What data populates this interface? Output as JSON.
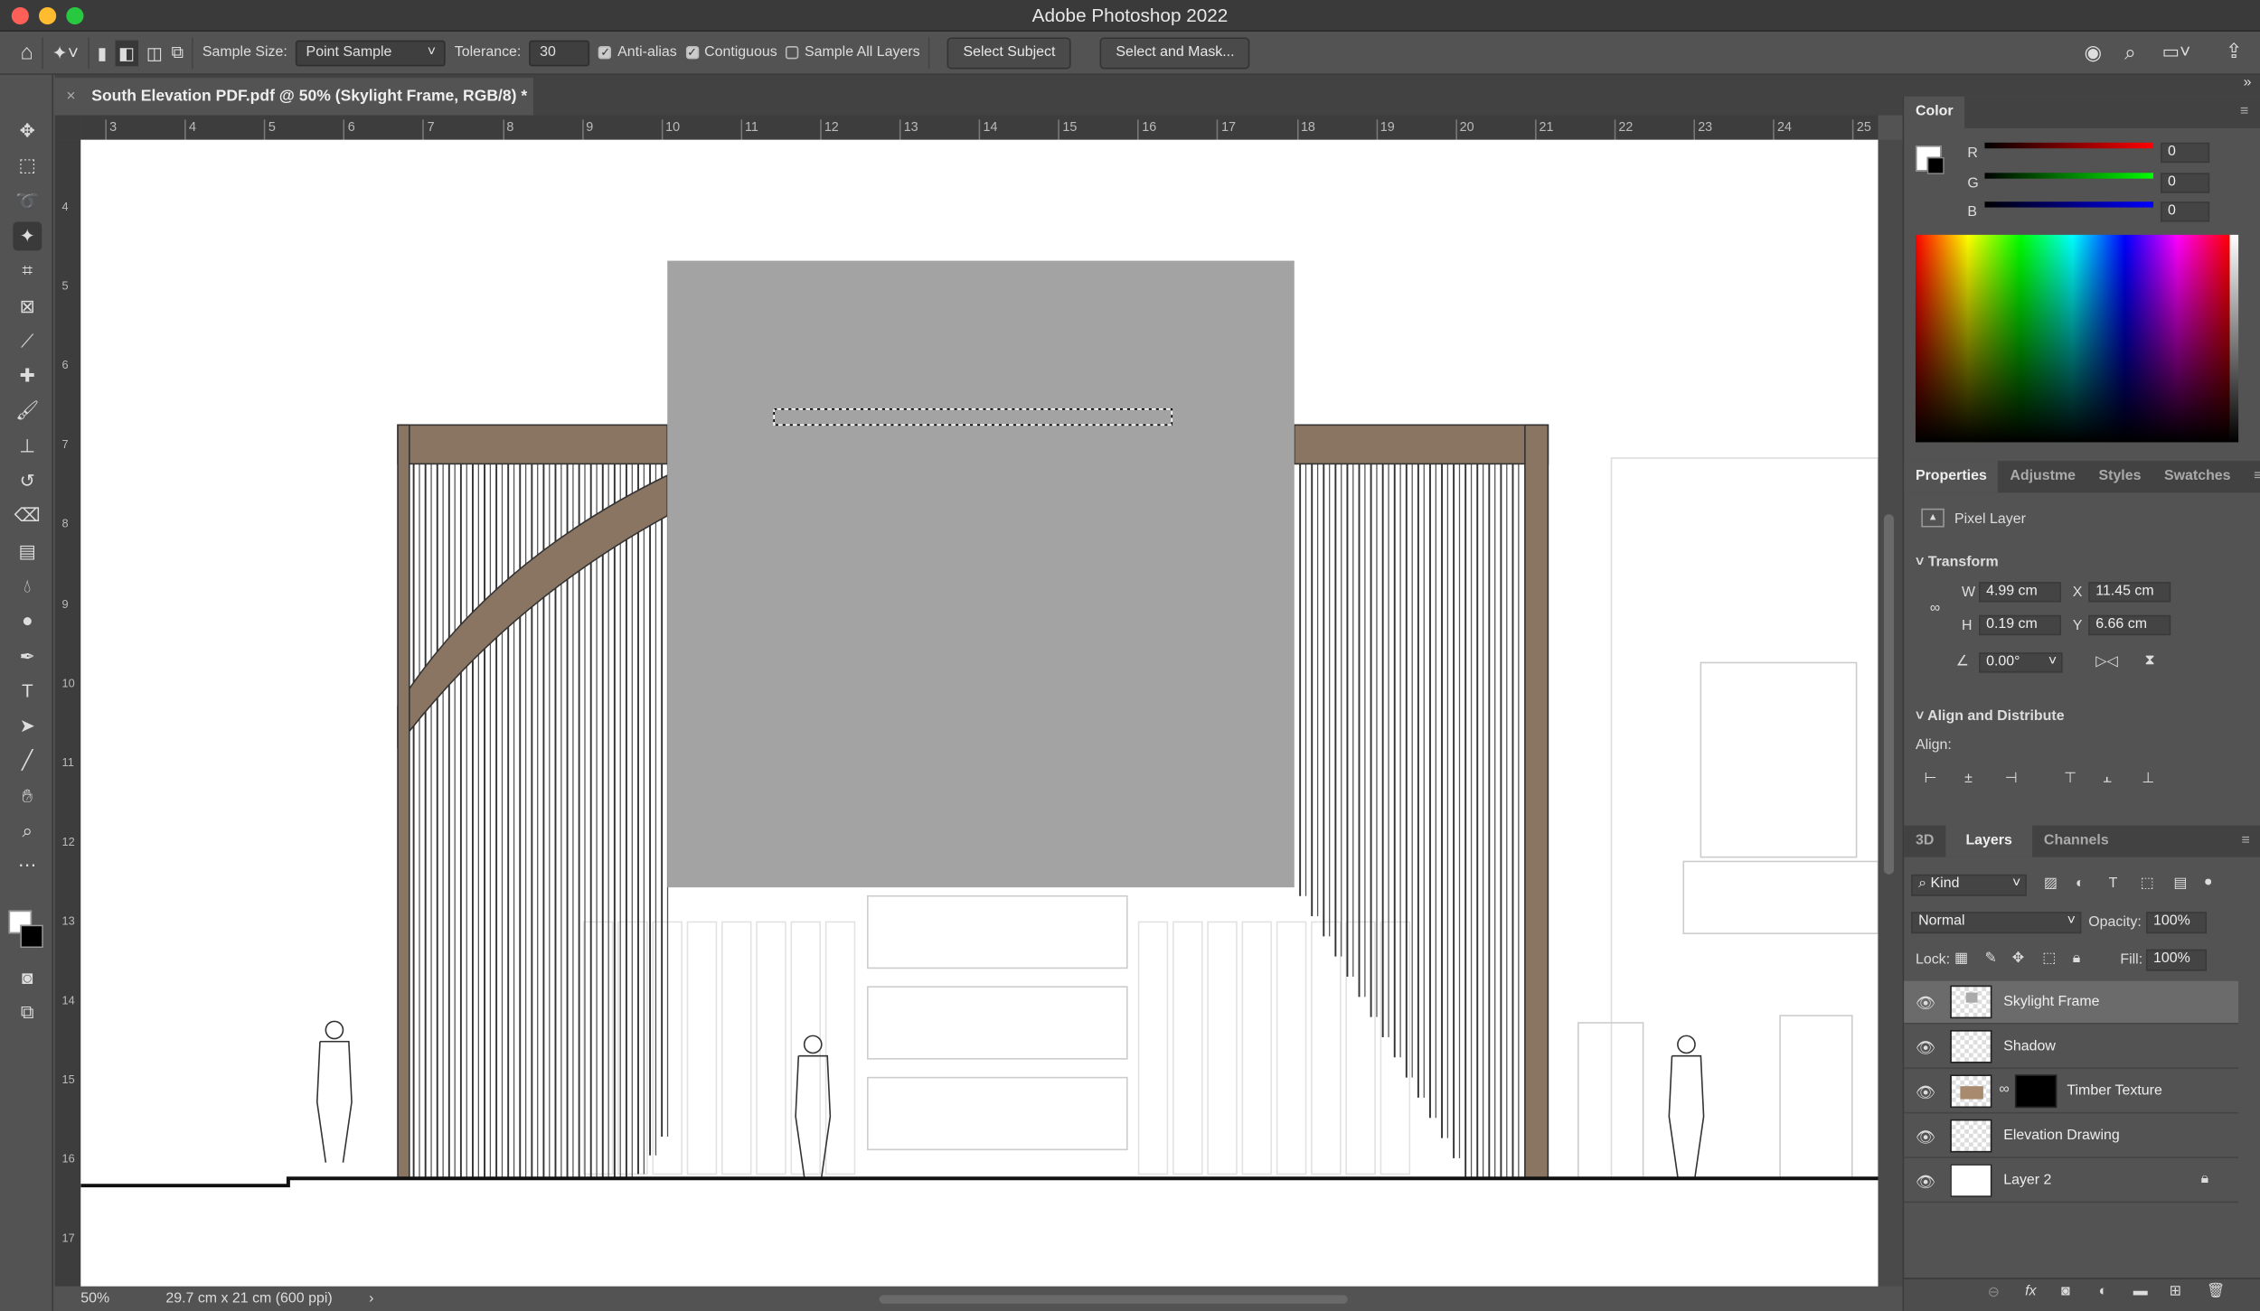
{
  "window": {
    "title": "Adobe Photoshop 2022"
  },
  "options": {
    "sample_size_label": "Sample Size:",
    "sample_size_value": "Point Sample",
    "tolerance_label": "Tolerance:",
    "tolerance_value": "30",
    "anti_alias": "Anti-alias",
    "anti_alias_checked": true,
    "contiguous": "Contiguous",
    "contiguous_checked": true,
    "sample_all_layers": "Sample All Layers",
    "sample_all_checked": false,
    "select_subject": "Select Subject",
    "select_and_mask": "Select and Mask..."
  },
  "document": {
    "tab_title": "South Elevation PDF.pdf @ 50% (Skylight Frame, RGB/8) *",
    "close": "×"
  },
  "ruler": {
    "top": [
      "3",
      "4",
      "5",
      "6",
      "7",
      "8",
      "9",
      "10",
      "11",
      "12",
      "13",
      "14",
      "15",
      "16",
      "17",
      "18",
      "19",
      "20",
      "21",
      "22",
      "23",
      "24",
      "25"
    ],
    "left": [
      "4",
      "5",
      "6",
      "7",
      "8",
      "9",
      "10",
      "11",
      "12",
      "13",
      "14",
      "15",
      "16",
      "17"
    ]
  },
  "status": {
    "zoom": "50%",
    "doc_size": "29.7 cm x 21 cm (600 ppi)",
    "arrow": "›"
  },
  "color_panel": {
    "title": "Color",
    "r_label": "R",
    "g_label": "G",
    "b_label": "B",
    "r": "0",
    "g": "0",
    "b": "0"
  },
  "properties": {
    "tabs": [
      "Properties",
      "Adjustme",
      "Styles",
      "Swatches"
    ],
    "layer_type": "Pixel Layer",
    "transform_label": "Transform",
    "w_label": "W",
    "w": "4.99 cm",
    "x_label": "X",
    "x": "11.45 cm",
    "h_label": "H",
    "h": "0.19 cm",
    "y_label": "Y",
    "y": "6.66 cm",
    "angle": "0.00°",
    "align_distribute": "Align and Distribute",
    "align_label": "Align:"
  },
  "layers_panel": {
    "tabs": [
      "3D",
      "Layers",
      "Channels"
    ],
    "filter": "Kind",
    "blend_mode": "Normal",
    "opacity_label": "Opacity:",
    "opacity": "100%",
    "lock_label": "Lock:",
    "fill_label": "Fill:",
    "fill": "100%",
    "layers": [
      {
        "name": "Skylight Frame",
        "selected": true
      },
      {
        "name": "Shadow"
      },
      {
        "name": "Timber Texture"
      },
      {
        "name": "Elevation Drawing"
      },
      {
        "name": "Layer 2",
        "locked": true
      }
    ]
  },
  "colors": {
    "accent_timber": "#8a7462",
    "placeholder_gray": "#a3a3a3"
  }
}
